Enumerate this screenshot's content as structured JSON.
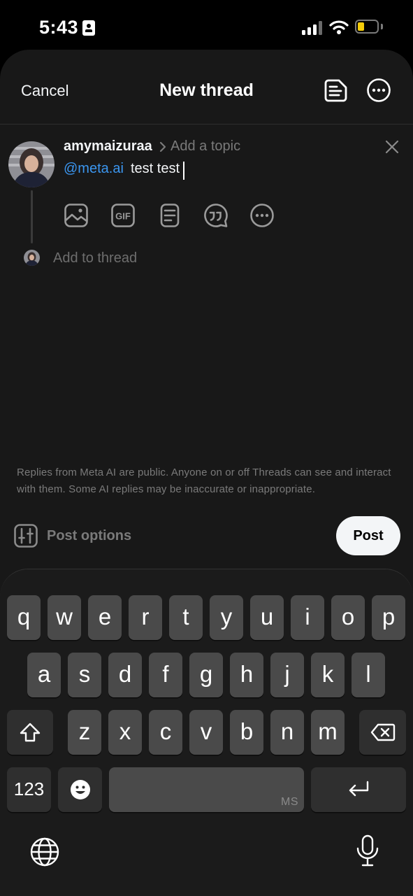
{
  "status_bar": {
    "time": "5:43",
    "icons": [
      "id-card-icon",
      "signal-icon",
      "wifi-icon",
      "battery-icon"
    ],
    "battery_level": 0.25,
    "battery_color": "#f4cc0a"
  },
  "header": {
    "cancel_label": "Cancel",
    "title": "New thread",
    "icons": [
      "drafts-icon",
      "more-icon"
    ]
  },
  "composer": {
    "username": "amymaizuraa",
    "topic_placeholder": "Add a topic",
    "mention": "@meta.ai",
    "text": "test test",
    "attachment_icons": [
      "image-icon",
      "gif-icon",
      "text-attachment-icon",
      "quote-icon",
      "more-options-icon"
    ],
    "add_to_thread": "Add to thread"
  },
  "notice": "Replies from Meta AI are public. Anyone on or off Threads can see and interact with them. Some AI replies may be inaccurate or inappropriate.",
  "footer": {
    "post_options_label": "Post options",
    "post_label": "Post"
  },
  "keyboard": {
    "row1": [
      "q",
      "w",
      "e",
      "r",
      "t",
      "y",
      "u",
      "i",
      "o",
      "p"
    ],
    "row2": [
      "a",
      "s",
      "d",
      "f",
      "g",
      "h",
      "j",
      "k",
      "l"
    ],
    "row3": [
      "z",
      "x",
      "c",
      "v",
      "b",
      "n",
      "m"
    ],
    "numbers_label": "123",
    "space_hint": "MS",
    "icons": [
      "shift-icon",
      "backspace-icon",
      "emoji-icon",
      "return-icon",
      "globe-icon",
      "microphone-icon"
    ]
  },
  "colors": {
    "sheet_bg": "#181818",
    "mention": "#3b96f0",
    "key": "#4a4a4a",
    "key_dark": "#2f2f2f"
  }
}
